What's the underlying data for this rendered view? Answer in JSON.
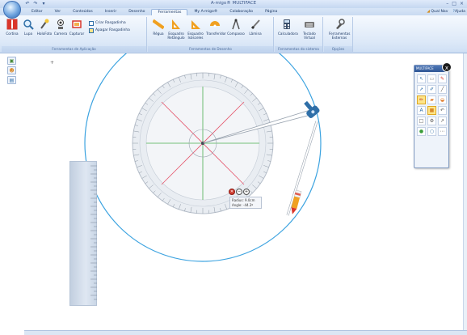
{
  "window": {
    "title": "A-migo® MULTIFACE",
    "controls": [
      "–",
      "□",
      "×"
    ]
  },
  "menu": {
    "tabs": [
      "Editar",
      "Ver",
      "Conteúdos",
      "Inserir",
      "Desenho",
      "Ferramentas",
      "My A-migo®",
      "Colaboração",
      "Página"
    ],
    "active_tab": "Ferramentas",
    "right_links": [
      "Qual Nav",
      "Ajuda"
    ]
  },
  "ribbon": {
    "group_aplicacao": {
      "label": "Ferramentas de Aplicação",
      "buttons": [
        "Cortina",
        "Lupa",
        "HoloFoto",
        "Camera",
        "Capturar"
      ],
      "small_buttons": [
        "Criar Rasgadinha",
        "Apagar Rasgadinha"
      ]
    },
    "group_desenho": {
      "label": "Ferramentas de Desenho",
      "buttons": [
        "Régua",
        "Esquadro Retângulo",
        "Esquadro Isósceles",
        "Transferidor",
        "Compasso",
        "Lâmina"
      ]
    },
    "group_sistema": {
      "label": "Ferramentas do sistema",
      "buttons": [
        "Calculadora",
        "Teclado Virtual"
      ]
    },
    "group_opcoes": {
      "label": "Opções",
      "buttons": [
        "Ferramentas Externas"
      ]
    }
  },
  "toolbox": {
    "title": "MULTIFACE",
    "close_label": "x"
  },
  "measurement": {
    "radius": "Radius: 9.0cm",
    "angle": "Angle: -44.3º"
  },
  "icons": [
    "cortina-icon",
    "lupa-icon",
    "holofoto-icon",
    "camera-icon",
    "capturar-icon",
    "regua-icon",
    "esquadro-retangulo-icon",
    "esquadro-isosceles-icon",
    "transferidor-icon",
    "compasso-icon",
    "lamina-icon",
    "calculadora-icon",
    "teclado-icon",
    "ferramentas-externas-icon"
  ],
  "colors": {
    "circle": "#3ca3e0",
    "protractor_red": "#e5566c",
    "protractor_green": "#4caf50",
    "compass_head": "#2f6fa8"
  }
}
